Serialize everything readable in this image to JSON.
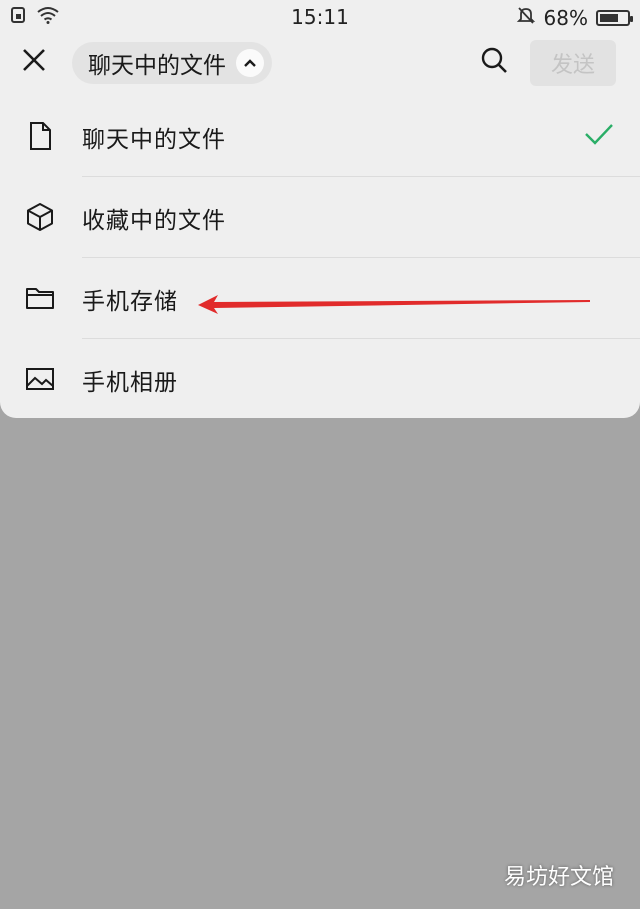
{
  "status_bar": {
    "time": "15:11",
    "battery": "68%",
    "battery_level": 0.68,
    "icons": [
      "sim-icon",
      "wifi-icon",
      "bell-off-icon",
      "battery-icon"
    ]
  },
  "top_bar": {
    "close_icon": "close-icon",
    "dropdown_label": "聊天中的文件",
    "dropdown_icon": "chevron-up-icon",
    "search_icon": "search-icon",
    "send_label": "发送"
  },
  "menu": {
    "items": [
      {
        "label": "聊天中的文件",
        "icon": "file-icon",
        "selected": true
      },
      {
        "label": "收藏中的文件",
        "icon": "cube-icon",
        "selected": false
      },
      {
        "label": "手机存储",
        "icon": "folder-icon",
        "selected": false
      },
      {
        "label": "手机相册",
        "icon": "image-icon",
        "selected": false
      }
    ]
  },
  "colors": {
    "panel_bg": "#efefef",
    "overlay_bg": "#a5a5a5",
    "check": "#2aae67",
    "annotation_arrow": "#e12b2b"
  },
  "watermark": "易坊好文馆"
}
